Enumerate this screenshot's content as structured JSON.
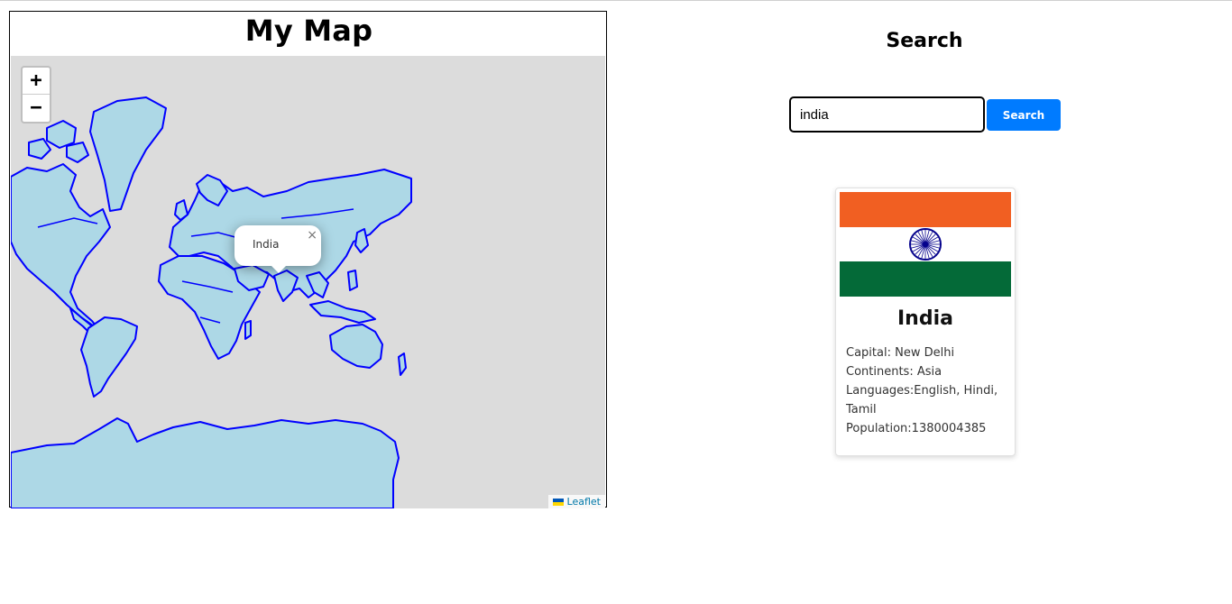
{
  "map": {
    "title": "My Map",
    "zoom_in_label": "+",
    "zoom_out_label": "−",
    "popup": {
      "text": "India",
      "close_label": "×"
    },
    "attribution": {
      "text": "Leaflet"
    },
    "colors": {
      "land": "#add8e6",
      "border": "#0000ff",
      "background": "#dcdcdc"
    }
  },
  "search": {
    "title": "Search",
    "input_value": "india",
    "button_label": "Search"
  },
  "country": {
    "name": "India",
    "capital": "Capital: New Delhi",
    "continents": "Continents: Asia",
    "languages": "Languages:English, Hindi, Tamil",
    "population": "Population:1380004385",
    "flag_colors": {
      "top": "#f15f22",
      "middle": "#ffffff",
      "bottom": "#046a38",
      "chakra": "#06038d"
    }
  }
}
